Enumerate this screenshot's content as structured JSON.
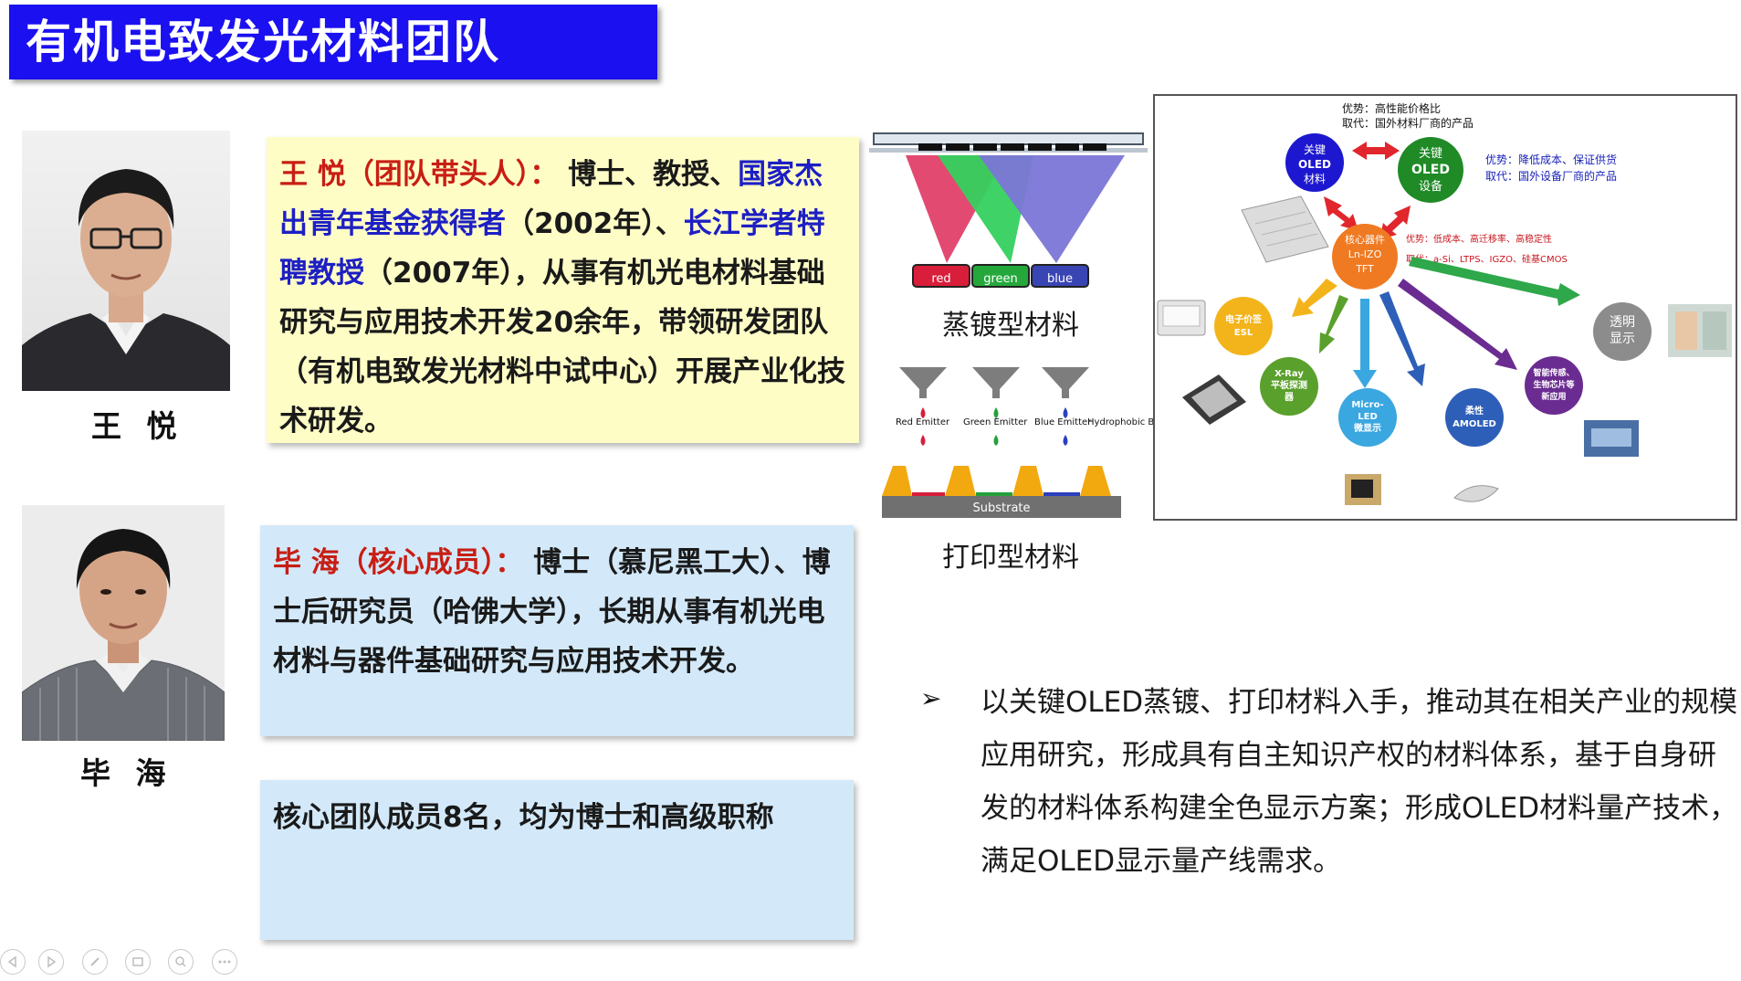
{
  "title": "有机电致发光材料团队",
  "people": [
    {
      "caption": "王  悦",
      "card": {
        "name_role": "王  悦（团队带头人）：",
        "part1": "  博士、教授、",
        "honor1": "国家杰出青年基金获得者",
        "part2": "（2002年）、",
        "honor2": "长江学者特聘教授",
        "part3": "（2007年），从事有机光电材料基础研究与应用技术开发20余年，带领研发团队（有机电致发光材料中试中心）开展产业化技术研发。"
      }
    },
    {
      "caption": "毕  海",
      "card": {
        "name_role": "毕    海（核心成员）：",
        "part1": "  博士（慕尼黑工大）、博士后研究员（哈佛大学），长期从事有机光电材料与器件基础研究与应用技术开发。"
      }
    }
  ],
  "team_card": "核心团队成员8名，均为博士和高级职称",
  "process_captions": {
    "evaporation": "蒸镀型材料",
    "printing": "打印型材料"
  },
  "evaporation_figure": {
    "cup_labels": [
      "red",
      "green",
      "blue"
    ]
  },
  "printing_figure": {
    "emitters": [
      "Red Emitter",
      "Green Emitter",
      "Blue Emitter"
    ],
    "banks_label": "Hydrophobic Banks",
    "substrate_label": "Substrate"
  },
  "diagram": {
    "top_advantage": "优势：高性能价格比",
    "top_replace": "取代：国外材料厂商的产品",
    "node_material": [
      "关键",
      "OLED",
      "材料"
    ],
    "node_equipment": [
      "关键",
      "OLED",
      "设备"
    ],
    "equipment_advantage": "优势：降低成本、保证供货",
    "equipment_replace": "取代：国外设备厂商的产品",
    "core_device": [
      "核心器件",
      "Ln-IZO",
      "TFT"
    ],
    "core_advantage": "优势：低成本、高迁移率、高稳定性",
    "core_replace": "取代：a-Si、LTPS、IGZO、硅基CMOS",
    "applications": [
      {
        "lines": [
          "电子价签",
          "ESL"
        ],
        "color": "#f3b41b"
      },
      {
        "lines": [
          "X-Ray",
          "平板探测",
          "器"
        ],
        "color": "#5aa02c"
      },
      {
        "lines": [
          "Micro-",
          "LED",
          "微显示"
        ],
        "color": "#3aa7e0"
      },
      {
        "lines": [
          "柔性",
          "AMOLED"
        ],
        "color": "#2e5fb8"
      },
      {
        "lines": [
          "智能传感、",
          "生物芯片等",
          "新应用"
        ],
        "color": "#6b2c91"
      },
      {
        "lines": [
          "透明",
          "显示"
        ],
        "color": "#8c8c8c"
      }
    ]
  },
  "bullet_symbol": "➢",
  "bullet_text": "以关键OLED蒸镀、打印材料入手，推动其在相关产业的规模应用研究，形成具有自主知识产权的材料体系，基于自身研发的材料体系构建全色显示方案；形成OLED材料量产技术，满足OLED显示量产线需求。",
  "nav_icons": [
    "prev-icon",
    "next-icon",
    "pen-icon",
    "slides-icon",
    "zoom-icon",
    "more-icon"
  ],
  "colors": {
    "title_bg": "#1a10f0",
    "card_yellow": "#fffdc6",
    "card_blue": "#d3e9fa",
    "red_text": "#c81e14",
    "blue_text": "#1d1fc4"
  }
}
